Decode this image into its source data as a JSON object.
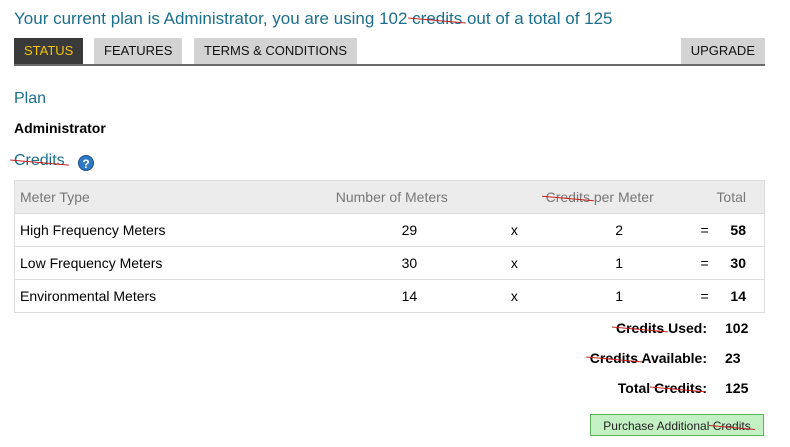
{
  "headline": {
    "prefix": "Your current plan is Administrator, you are using 102 ",
    "struck_word": "credits",
    "suffix": " out of a total of 125"
  },
  "tabs": {
    "status": "STATUS",
    "features": "FEATURES",
    "terms": "TERMS & CONDITIONS",
    "upgrade": "UPGRADE"
  },
  "plan": {
    "heading": "Plan",
    "name": "Administrator"
  },
  "credits_section": {
    "heading": "Credits",
    "help_icon": "?"
  },
  "table": {
    "headers": {
      "meter_type": "Meter Type",
      "number_of_meters": "Number of Meters",
      "per_meter_struck": "Credits",
      "per_meter_suffix": " per Meter",
      "total": "Total"
    },
    "rows": [
      {
        "type": "High Frequency Meters",
        "count": "29",
        "times": "x",
        "per": "2",
        "eq": "=",
        "total": "58"
      },
      {
        "type": "Low Frequency Meters",
        "count": "30",
        "times": "x",
        "per": "1",
        "eq": "=",
        "total": "30"
      },
      {
        "type": "Environmental Meters",
        "count": "14",
        "times": "x",
        "per": "1",
        "eq": "=",
        "total": "14"
      }
    ]
  },
  "summary": {
    "used": {
      "struck": "Credits",
      "suffix": " Used:",
      "value": "102"
    },
    "available": {
      "struck": "Credits",
      "suffix": " Available:",
      "value": "23"
    },
    "total": {
      "prefix": "Total ",
      "struck": "Credits",
      "suffix": ":",
      "value": "125"
    }
  },
  "purchase_button": {
    "prefix": "Purchase Additional ",
    "struck": "Credits"
  },
  "colors": {
    "heading": "#1b6f8c",
    "active_tab_bg": "#3a3a3a",
    "active_tab_text": "#f2c40c",
    "strike": "#c8201e",
    "button_bg": "#c3f1c3"
  }
}
